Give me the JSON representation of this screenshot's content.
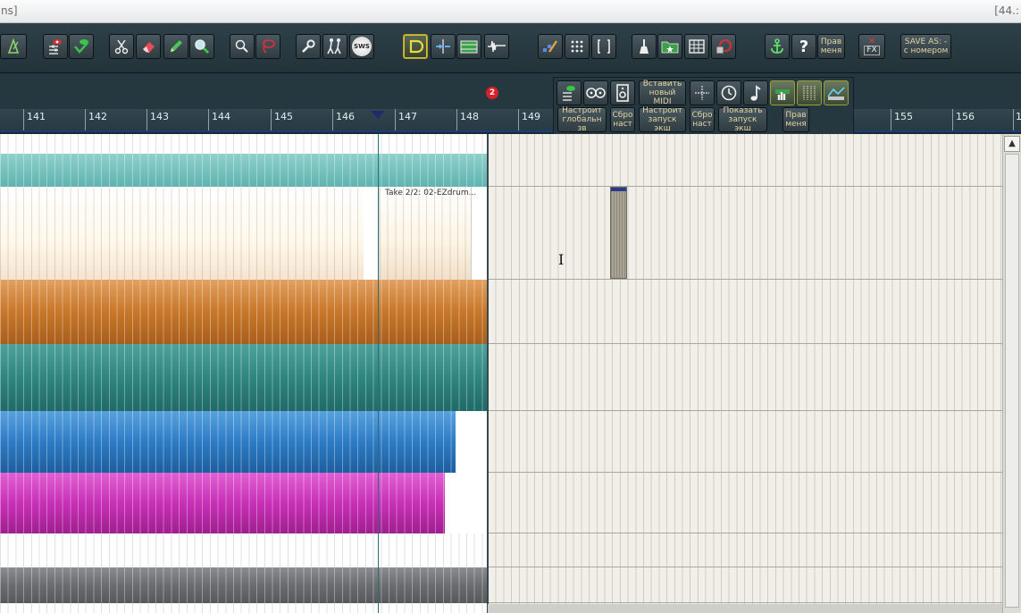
{
  "window": {
    "title_fragment": "ns]",
    "title_right_fragment": "[44.:"
  },
  "toolbar": {
    "save_as_line1": "SAVE AS: -",
    "save_as_line2": "с номером",
    "edit_menu_line1": "Прав",
    "edit_menu_line2": "меня",
    "fx_label": "FX",
    "sws_label": "SWS"
  },
  "floating_toolbar": {
    "insert_midi_line1": "Вставить",
    "insert_midi_line2": "новый MIDI",
    "global_settings_line1": "Настроит",
    "global_settings_line2": "глобальн зв",
    "reset_line1": "Сбро",
    "reset_line2": "наст",
    "launch_settings_line1": "Настроит",
    "launch_settings_line2": "запуск экш",
    "reset2_line1": "Сбро",
    "reset2_line2": "наст",
    "show_launch_line1": "Показать",
    "show_launch_line2": "запуск экш",
    "edit_menu_line1": "Прав",
    "edit_menu_line2": "меня"
  },
  "ruler": {
    "bars": [
      "141",
      "142",
      "143",
      "144",
      "145",
      "146",
      "147",
      "148",
      "149",
      "155",
      "156",
      "1"
    ],
    "marker_number": "2"
  },
  "arrange": {
    "take_label": "Take 2/2: 02-EZdrum..."
  },
  "colors": {
    "track_teal_light": "#5fb3b0",
    "track_orange": "#c8772a",
    "track_teal_dark": "#2f8580",
    "track_blue": "#2c7bc4",
    "track_magenta": "#c830b6",
    "track_gray": "#6a6c70"
  }
}
